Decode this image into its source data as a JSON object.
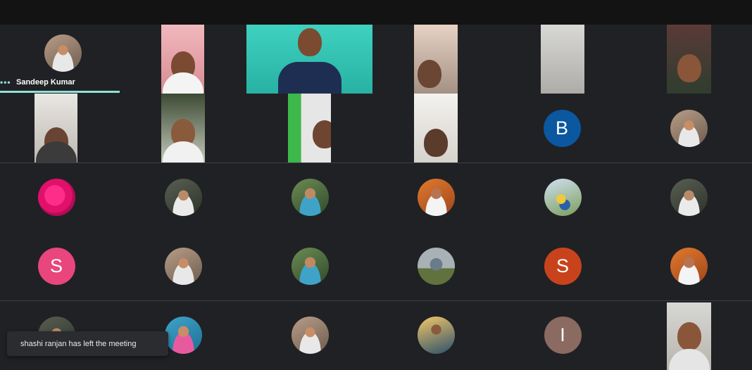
{
  "meeting": {
    "highlighted_participant": {
      "name": "Sandeep Kumar"
    }
  },
  "participants": [
    {
      "label": "B",
      "color": "#0b57a0"
    },
    {
      "label": "S",
      "color": "#e8467c"
    },
    {
      "label": "S",
      "color": "#c8431c"
    },
    {
      "label": "I",
      "color": "#8a6a61"
    }
  ],
  "notification": {
    "text": "shashi ranjan has left the meeting"
  }
}
